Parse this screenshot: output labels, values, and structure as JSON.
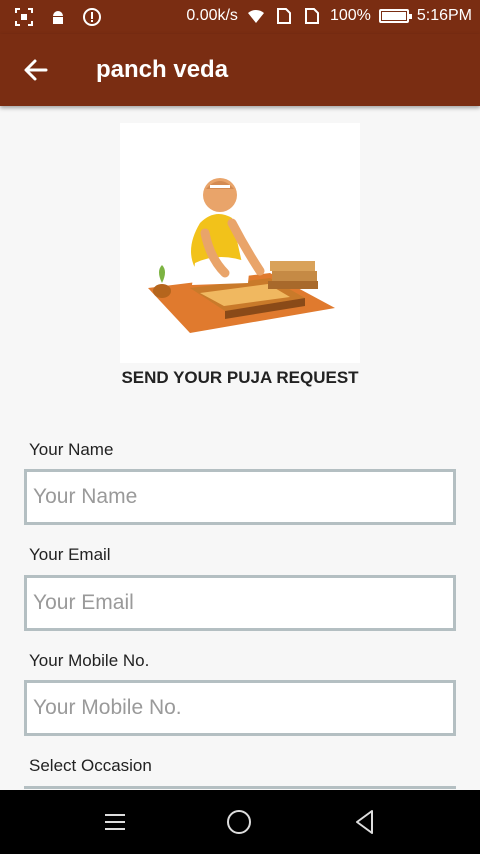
{
  "status_bar": {
    "speed": "0.00k/s",
    "battery_percent": "100%",
    "battery_level": 1.0,
    "time": "5:16PM",
    "icons": [
      "screenshot-icon",
      "android-icon",
      "alert-icon",
      "wifi-icon",
      "sim1-icon",
      "sim2-icon",
      "battery-icon"
    ]
  },
  "app_bar": {
    "title": "panch veda",
    "back_icon": "back-arrow-icon"
  },
  "main": {
    "heading": "SEND YOUR PUJA REQUEST",
    "form": {
      "name": {
        "label": "Your Name",
        "placeholder": "Your Name",
        "value": ""
      },
      "email": {
        "label": "Your Email",
        "placeholder": "Your Email",
        "value": ""
      },
      "mobile": {
        "label": "Your Mobile No.",
        "placeholder": "Your Mobile No.",
        "value": ""
      },
      "occasion": {
        "label": "Select Occasion"
      }
    }
  },
  "nav_bar": {
    "icons": [
      "menu-icon",
      "home-icon",
      "back-icon"
    ]
  },
  "colors": {
    "primary": "#7a2d12",
    "field_border": "#b4bfc2",
    "background": "#f7f7f7"
  }
}
